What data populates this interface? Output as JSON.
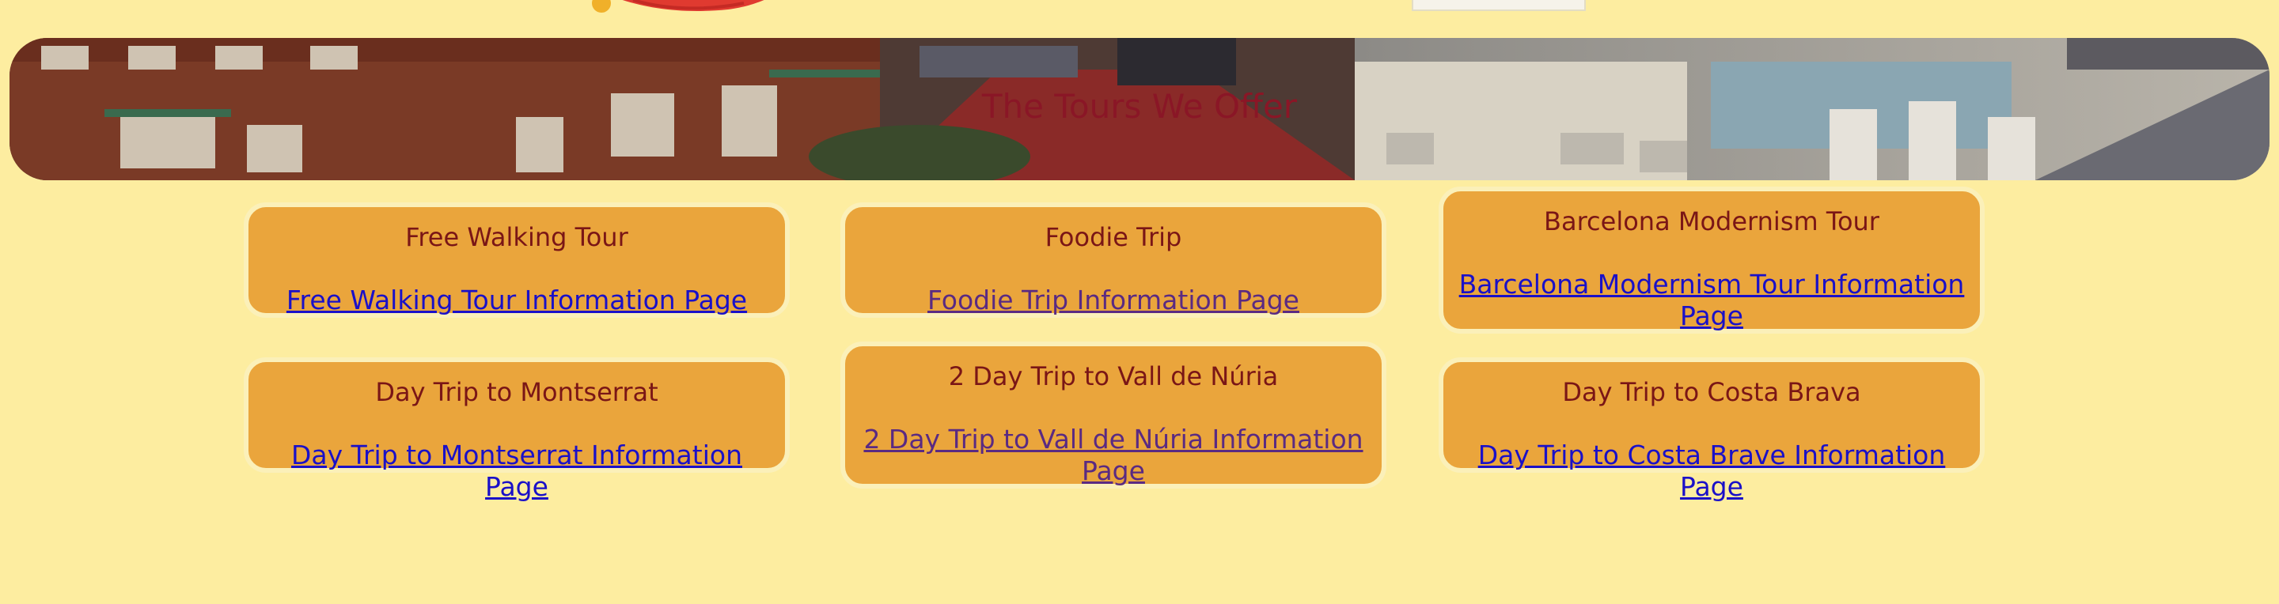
{
  "hero": {
    "title": "The Tours We Offer"
  },
  "tours": [
    {
      "title": "Free Walking Tour",
      "link": "Free Walking Tour Information Page"
    },
    {
      "title": "Foodie Trip",
      "link": "Foodie Trip Information Page"
    },
    {
      "title": "Barcelona Modernism Tour",
      "link": "Barcelona Modernism Tour Information Page"
    },
    {
      "title": "Day Trip to Montserrat",
      "link": "Day Trip to Montserrat Information Page"
    },
    {
      "title": "2 Day Trip to Vall de Núria",
      "link": "2 Day Trip to Vall de Núria Information Page"
    },
    {
      "title": "Day Trip to Costa Brava",
      "link": "Day Trip to Costa Brave Information Page"
    }
  ],
  "colors": {
    "page_background": "#fdeda0",
    "card_background": "#eaa53c",
    "card_border": "#fbf0b9",
    "title_text": "#7a1616",
    "hero_title": "#8a1626",
    "link": "#1a10c8",
    "link_visited": "#5a2a82"
  }
}
